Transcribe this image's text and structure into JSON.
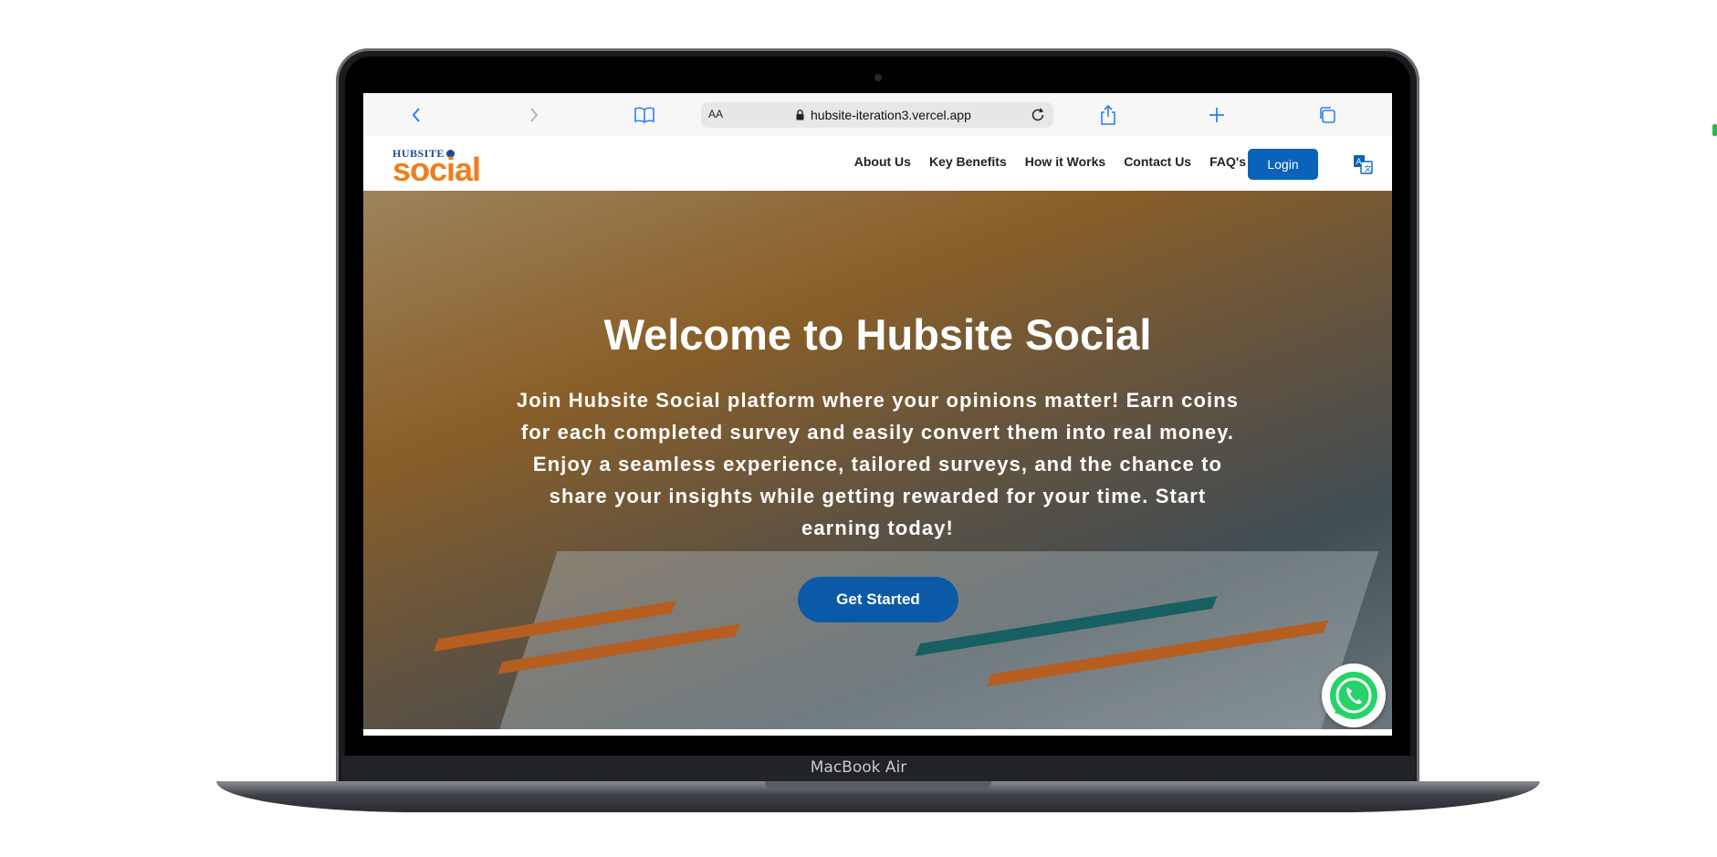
{
  "device": {
    "label": "MacBook Air"
  },
  "browser": {
    "aa_label": "AA",
    "url": "hubsite-iteration3.vercel.app",
    "icons": [
      "back-icon",
      "forward-icon",
      "bookmarks-icon",
      "lock-icon",
      "reload-icon",
      "share-icon",
      "new-tab-icon",
      "tabs-icon"
    ]
  },
  "site": {
    "logo": {
      "top": "HUBSITE",
      "main": "social"
    },
    "nav": [
      "About Us",
      "Key Benefits",
      "How it Works",
      "Contact Us",
      "FAQ's"
    ],
    "login_label": "Login"
  },
  "hero": {
    "title": "Welcome to Hubsite Social",
    "text": "Join Hubsite Social platform where your opinions matter! Earn coins for each completed survey and easily convert them into real money. Enjoy a seamless experience, tailored surveys, and the chance to share your insights while getting rewarded for your time. Start earning today!",
    "cta_label": "Get Started"
  },
  "colors": {
    "brand_blue": "#0a63b8",
    "brand_orange": "#f07e1c",
    "whatsapp_green": "#25d366"
  }
}
